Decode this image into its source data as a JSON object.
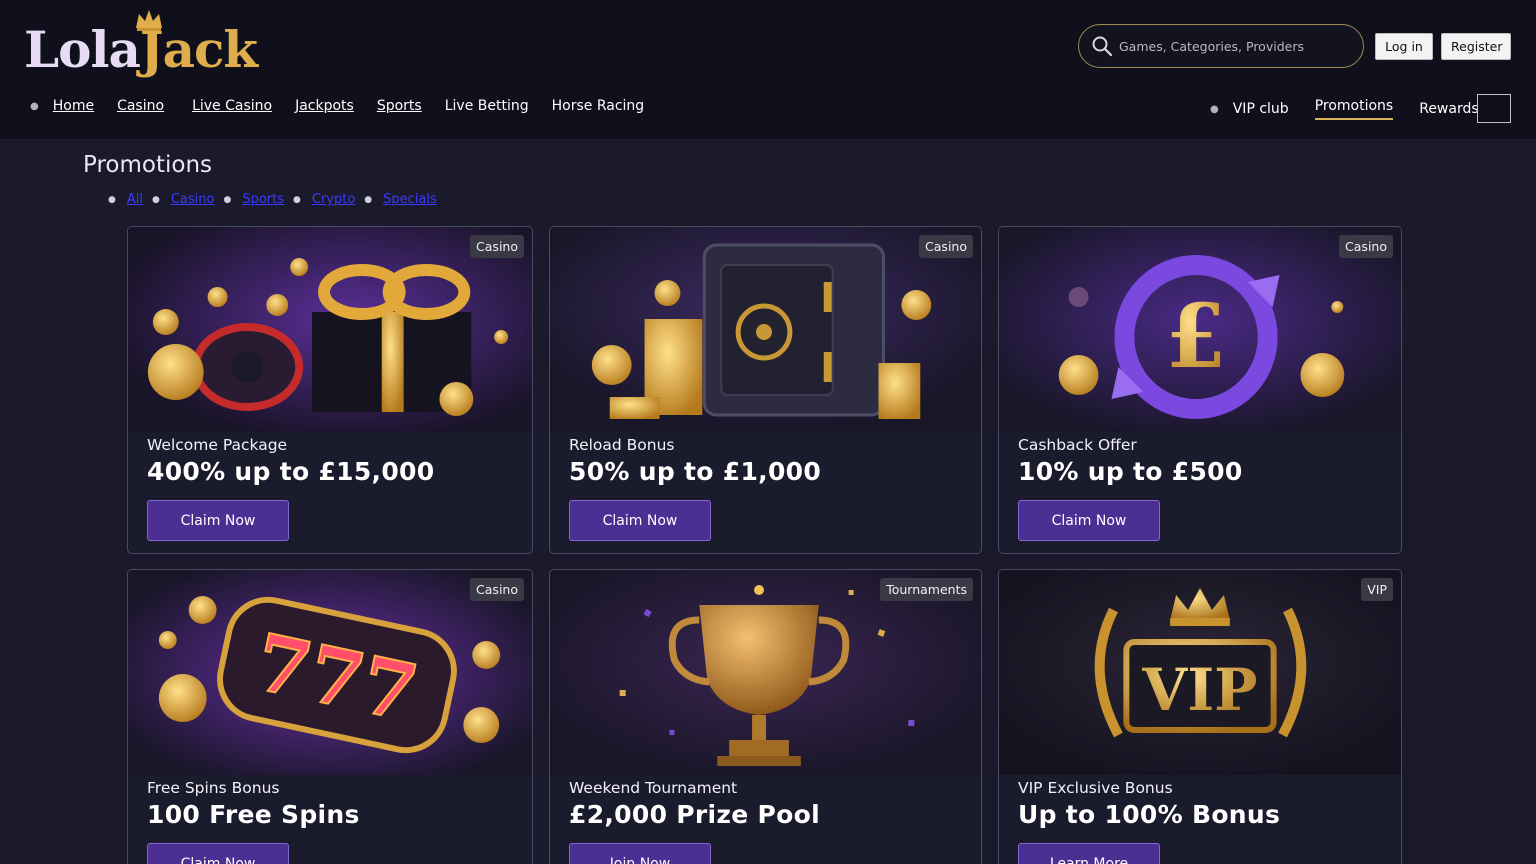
{
  "brand": {
    "name_part1": "Lola",
    "name_part2": "Jack",
    "gold": "#e0ad4c",
    "accent": "#4b2f93"
  },
  "search": {
    "placeholder": "Games, Categories, Providers",
    "icon": "search-icon"
  },
  "auth": {
    "login_label": "Log in",
    "register_label": "Register"
  },
  "nav": {
    "left": [
      "Home",
      "Casino",
      "Live Casino",
      "Jackpots",
      "Sports",
      "Live Betting",
      "Horse Racing"
    ],
    "right": [
      "VIP club",
      "Promotions",
      "Rewards"
    ],
    "active": "Promotions"
  },
  "page": {
    "title": "Promotions"
  },
  "filters": [
    "All",
    "Casino",
    "Sports",
    "Crypto",
    "Specials"
  ],
  "cards": [
    {
      "badge": "Casino",
      "subtitle": "Welcome Package",
      "headline": "400% up to £15,000",
      "cta": "Claim Now",
      "art": "gift-roulette-coins"
    },
    {
      "badge": "Casino",
      "subtitle": "Reload Bonus",
      "headline": "50% up to £1,000",
      "cta": "Claim Now",
      "art": "safe-coins"
    },
    {
      "badge": "Casino",
      "subtitle": "Cashback Offer",
      "headline": "10% up to £500",
      "cta": "Claim Now",
      "art": "pound-cycle"
    },
    {
      "badge": "Casino",
      "subtitle": "Free Spins Bonus",
      "headline": "100 Free Spins",
      "cta": "Claim Now",
      "art": "slot-777"
    },
    {
      "badge": "Tournaments",
      "subtitle": "Weekend Tournament",
      "headline": "£2,000 Prize Pool",
      "cta": "Join Now",
      "art": "trophy"
    },
    {
      "badge": "VIP",
      "subtitle": "VIP Exclusive Bonus",
      "headline": "Up to 100% Bonus",
      "cta": "Learn More",
      "art": "vip-crown"
    }
  ]
}
